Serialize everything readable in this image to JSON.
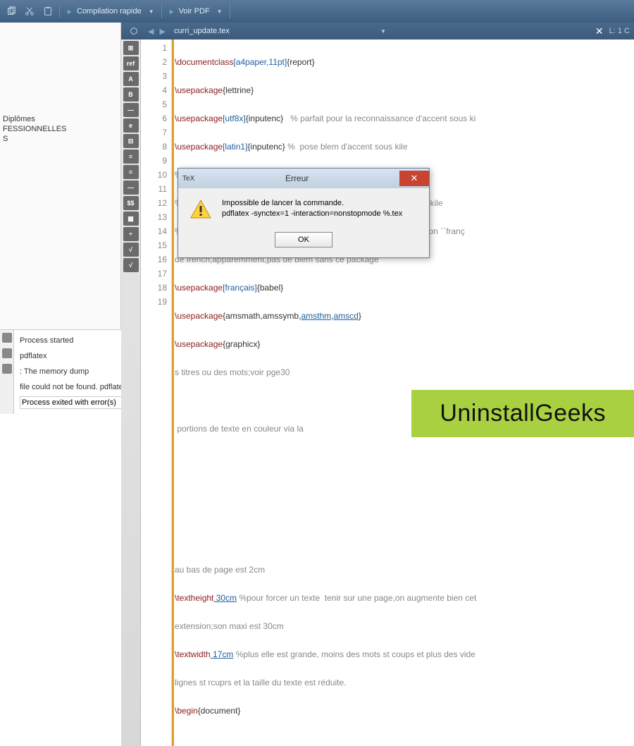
{
  "toolbar": {
    "compile_label": "Compilation rapide",
    "view_label": "Voir PDF"
  },
  "tab": {
    "filename": "curri_update.tex",
    "position": "L: 1 C"
  },
  "left": {
    "item1": "Diplômes",
    "item2": "FESSIONNELLES",
    "item3": "S"
  },
  "gutter": [
    "1",
    "2",
    "3",
    "4",
    "5",
    "6",
    "7",
    "",
    "8",
    "9",
    "10",
    "11",
    "",
    "12",
    "",
    "13",
    "14",
    "15",
    "16",
    "17",
    "",
    "18",
    "",
    "19"
  ],
  "code": {
    "l1a": "\\documentclass",
    "l1b": "[a4paper,11pt]",
    "l1c": "{report}",
    "l2a": "\\usepackage",
    "l2c": "{lettrine}",
    "l3a": "\\usepackage",
    "l3b": "[utf8x]",
    "l3c": "{inputenc}",
    "l3d": "   % parfait pour la reconnaissance d'accent sous ki",
    "l4a": "\\usepackage",
    "l4b": "[latin1]",
    "l4c": "{inputenc}",
    "l4d": " %  pose blem d'accent sous kile",
    "l5": "%\\usepackage[utf8]{babel}       %      à  ne pas libérer sous kile",
    "l6": "%\\usepackage[T1]{fontenc}       %              pose blem d'accent sous kile",
    "l7": "%\\usepackage[french]{babel} % il y a blem sous kile ,si on met l'option ``franç",
    "l7b": "de french;apparemment,pas de blem sans ce package",
    "l8a": "\\usepackage",
    "l8b": "[français]",
    "l8c": "{babel}",
    "l9a": "\\usepackage",
    "l9c": "{amsmath,amssymb,",
    "l9d": "amsthm",
    "l9e": ",",
    "l9f": "amscd",
    "l9g": "}",
    "l10a": "\\usepackage",
    "l10c": "{graphicx}",
    "l11d": "s titres ou des mots;voir pge30",
    "l12d": " portions de texte en couleur via la",
    "l16d": "au bas de page est 2cm",
    "l17a": "\\textheight",
    "l17b": " 30cm",
    "l17c": " %pour forcer un texte  tenir sur une page,on augmente bien cet",
    "l17d": "extension;son maxi est 30cm",
    "l18a": "\\textwidth",
    "l18b": " 17cm",
    "l18c": " %plus elle est grande, moins des mots st coups et plus des vide",
    "l18d": "lignes st rcuprs et la taille du texte est réduite.",
    "l19a": "\\begin",
    "l19c": "{document}"
  },
  "bottom": {
    "l1": "Process started",
    "l2": "pdflatex",
    "l3": ": The memory dump",
    "l4": "file could not be found. pdflatex: Data: pdflatex.fmt",
    "l5": "Process exited with error(s)"
  },
  "dialog": {
    "title": "Erreur",
    "msg1": "Impossible de lancer la commande.",
    "msg2": "pdflatex -synctex=1 -interaction=nonstopmode %.tex",
    "ok": "OK"
  },
  "watermark": "UninstallGeeks"
}
